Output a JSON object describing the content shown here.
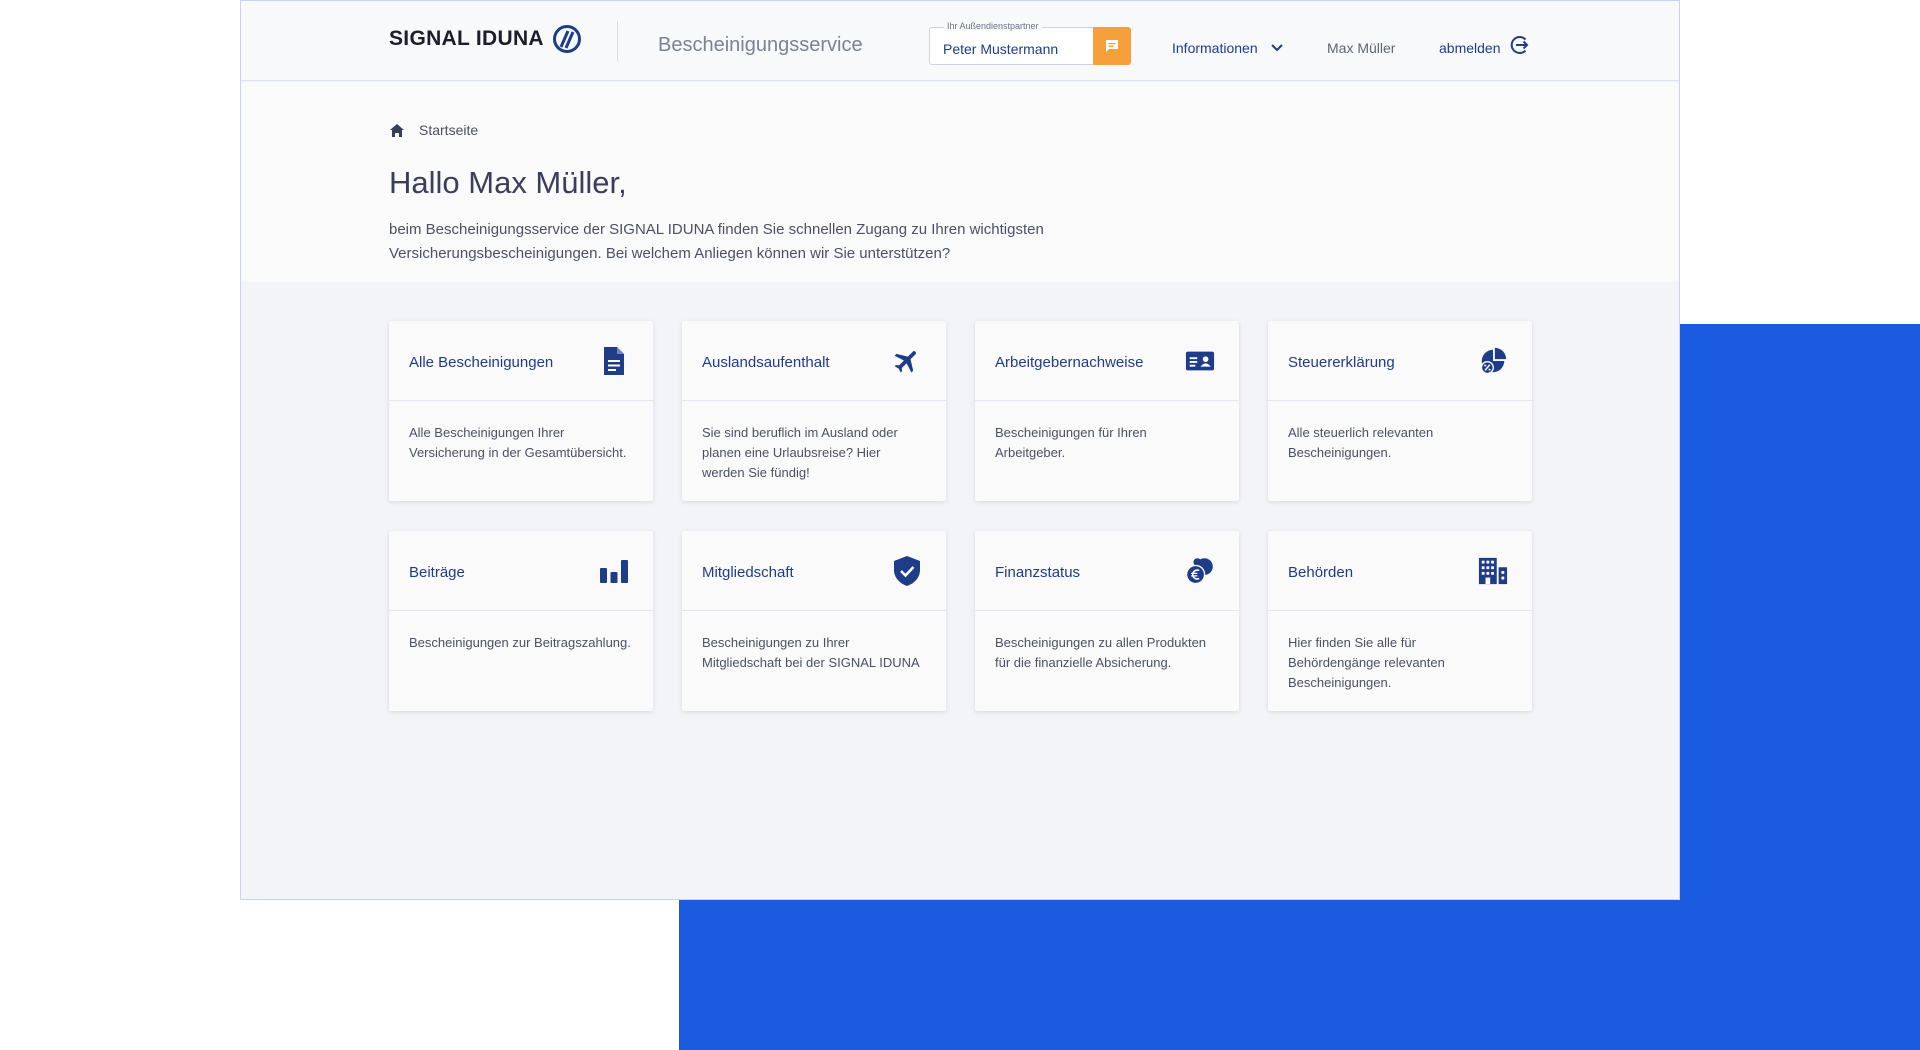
{
  "header": {
    "logo_text": "SIGNAL IDUNA",
    "service_title": "Bescheinigungsservice",
    "partner_label": "Ihr Außendienstpartner",
    "partner_value": "Peter Mustermann",
    "nav_info": "Informationen",
    "user_name": "Max Müller",
    "logout": "abmelden"
  },
  "breadcrumb": {
    "label": "Startseite"
  },
  "intro": {
    "greeting": "Hallo Max Müller,",
    "text": "beim Bescheinigungsservice der SIGNAL IDUNA finden Sie schnellen Zugang zu Ihren wichtigsten Versicherungsbescheinigungen. Bei welchem Anliegen können wir Sie unterstützen?"
  },
  "cards": [
    {
      "title": "Alle Bescheinigungen",
      "icon": "document-icon",
      "desc": "Alle Bescheinigungen Ihrer Versicherung in der Gesamtübersicht."
    },
    {
      "title": "Auslandsaufenthalt",
      "icon": "airplane-icon",
      "desc": "Sie sind beruflich im Ausland oder planen eine Urlaubsreise? Hier werden Sie fündig!"
    },
    {
      "title": "Arbeitgebernachweise",
      "icon": "id-card-icon",
      "desc": "Bescheinigungen für Ihren Arbeitgeber."
    },
    {
      "title": "Steuererklärung",
      "icon": "tax-pie-chart-icon",
      "desc": "Alle steuerlich relevanten Bescheinigungen."
    },
    {
      "title": "Beiträge",
      "icon": "bar-chart-icon",
      "desc": "Bescheinigungen zur Beitragszahlung."
    },
    {
      "title": "Mitgliedschaft",
      "icon": "shield-check-icon",
      "desc": "Bescheinigungen zu Ihrer Mitgliedschaft bei der SIGNAL IDUNA"
    },
    {
      "title": "Finanzstatus",
      "icon": "euro-coins-icon",
      "desc": "Bescheinigungen zu allen Produkten für die finanzielle Absicherung."
    },
    {
      "title": "Behörden",
      "icon": "office-building-icon",
      "desc": "Hier finden Sie alle für Behördengänge relevanten Bescheinigungen."
    }
  ],
  "colors": {
    "brand": "#1f3c88",
    "accent_orange": "#f6a03c",
    "background_blue": "#1a5be0"
  }
}
